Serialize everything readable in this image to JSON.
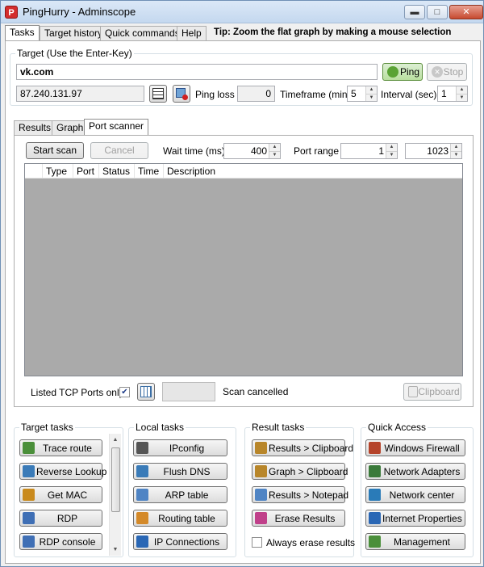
{
  "window": {
    "title": "PingHurry - Adminscope",
    "app_icon_glyph": "P",
    "controls": {
      "minimize": "▬",
      "maximize": "□",
      "close": "✕"
    }
  },
  "top_tabs": [
    "Tasks",
    "Target history",
    "Quick commands",
    "Help"
  ],
  "tip": "Tip: Zoom the flat graph by making a mouse selection",
  "target": {
    "group_label": "Target (Use the Enter-Key)",
    "host_value": "vk.com",
    "ip_value": "87.240.131.97",
    "ping_button": "Ping",
    "stop_button": "Stop",
    "ping_loss_label": "Ping loss",
    "ping_loss_value": "0",
    "timeframe_label": "Timeframe (min)",
    "timeframe_value": "5",
    "interval_label": "Interval (sec)",
    "interval_value": "1"
  },
  "inner_tabs": [
    "Results",
    "Graph",
    "Port scanner"
  ],
  "port_scanner": {
    "start_button": "Start scan",
    "cancel_button": "Cancel",
    "wait_time_label": "Wait time (ms)",
    "wait_time_value": "400",
    "port_range_label": "Port range",
    "port_from": "1",
    "port_to": "1023",
    "columns": [
      "Type",
      "Port",
      "Status",
      "Time",
      "Description"
    ],
    "listed_tcp_label": "Listed TCP Ports only",
    "listed_tcp_checked": true,
    "status_text": "Scan cancelled",
    "clipboard_button": "Clipboard"
  },
  "target_tasks": {
    "label": "Target tasks",
    "items": [
      {
        "label": "Trace route",
        "icon": "trace-route-icon",
        "color": "#4a8f3a"
      },
      {
        "label": "Reverse Lookup",
        "icon": "dns-icon",
        "color": "#3a7bb8"
      },
      {
        "label": "Get MAC",
        "icon": "mac-icon",
        "color": "#c98a1d"
      },
      {
        "label": "RDP",
        "icon": "rdp-icon",
        "color": "#3f6fb5"
      },
      {
        "label": "RDP console",
        "icon": "rdp-console-icon",
        "color": "#3f6fb5"
      }
    ]
  },
  "local_tasks": {
    "label": "Local tasks",
    "items": [
      {
        "label": "IPconfig",
        "icon": "ipconfig-icon",
        "color": "#555555"
      },
      {
        "label": "Flush DNS",
        "icon": "dns-icon",
        "color": "#3a7bb8"
      },
      {
        "label": "ARP table",
        "icon": "table-icon",
        "color": "#4f84c4"
      },
      {
        "label": "Routing table",
        "icon": "table-icon",
        "color": "#d48a2a"
      },
      {
        "label": "IP Connections",
        "icon": "connections-icon",
        "color": "#2a67b5"
      }
    ]
  },
  "result_tasks": {
    "label": "Result tasks",
    "items": [
      {
        "label": "Results > Clipboard",
        "icon": "clipboard-icon",
        "color": "#b8862a"
      },
      {
        "label": "Graph > Clipboard",
        "icon": "clipboard-icon",
        "color": "#b8862a"
      },
      {
        "label": "Results > Notepad",
        "icon": "notepad-icon",
        "color": "#4f84c4"
      },
      {
        "label": "Erase Results",
        "icon": "eraser-icon",
        "color": "#c0408a"
      }
    ],
    "always_erase_label": "Always erase results",
    "always_erase_checked": false
  },
  "quick_access": {
    "label": "Quick Access",
    "items": [
      {
        "label": "Windows Firewall",
        "icon": "firewall-icon",
        "color": "#b5432a"
      },
      {
        "label": "Network Adapters",
        "icon": "network-adapter-icon",
        "color": "#3a7a3a"
      },
      {
        "label": "Network center",
        "icon": "network-center-icon",
        "color": "#2a7bb8"
      },
      {
        "label": "Internet Properties",
        "icon": "internet-icon",
        "color": "#2a67b5"
      },
      {
        "label": "Management",
        "icon": "management-icon",
        "color": "#4a8f3a"
      }
    ]
  }
}
